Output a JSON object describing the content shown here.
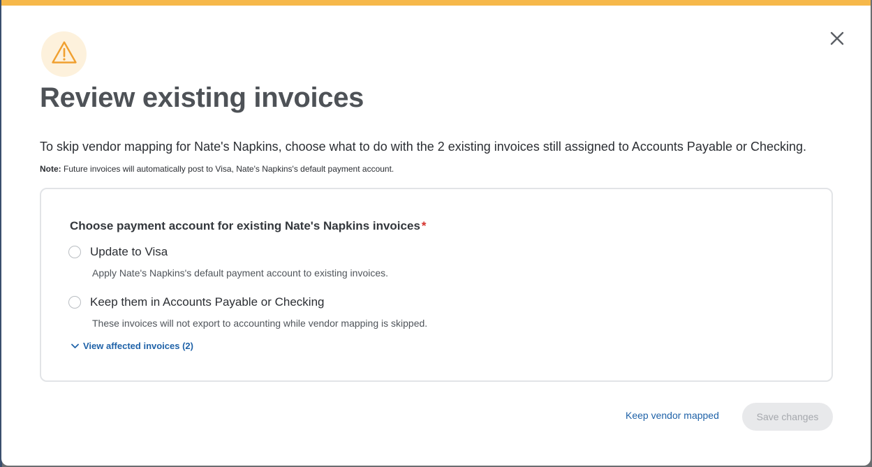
{
  "dialog": {
    "title": "Review existing invoices",
    "description": "To skip vendor mapping for Nate's Napkins, choose what to do with the 2 existing invoices still assigned to Accounts Payable or Checking.",
    "note_label": "Note:",
    "note_text": " Future invoices will automatically post to Visa, Nate's Napkins's default payment account.",
    "icons": {
      "header": "warning-triangle-icon",
      "close": "close-icon",
      "expand": "chevron-down-icon"
    }
  },
  "form": {
    "heading": "Choose payment account for existing Nate's Napkins invoices",
    "required_marker": "*",
    "options": [
      {
        "label": "Update to Visa",
        "help": "Apply Nate's Napkins's default payment account to existing invoices.",
        "selected": false
      },
      {
        "label": "Keep them in Accounts Payable or Checking",
        "help": "These invoices will not export to accounting while vendor mapping is skipped.",
        "selected": false
      }
    ],
    "view_affected_label": "View affected invoices (2)"
  },
  "footer": {
    "keep_mapped_label": "Keep vendor mapped",
    "save_label": "Save changes",
    "save_disabled": true
  },
  "colors": {
    "accent_bar": "#f6b84a",
    "warning_icon": "#f0a030",
    "warning_badge_bg": "#fdf1dc",
    "link": "#1f62a8",
    "required": "#d5312b"
  }
}
